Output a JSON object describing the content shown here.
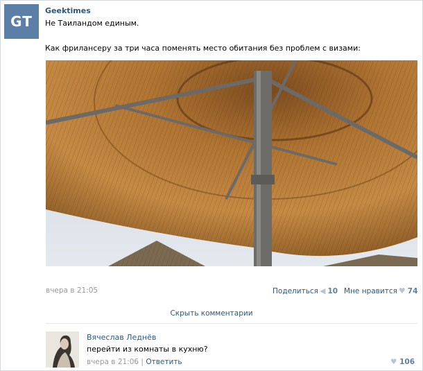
{
  "post": {
    "avatar_text": "GT",
    "author": "Geektimes",
    "line1": "Не Таиландом единым.",
    "line2": "Как фрилансеру за три часа поменять место обитания без проблем с визами:",
    "time": "вчера в 21:05",
    "share_label": "Поделиться",
    "share_count": "10",
    "like_label": "Мне нравится",
    "like_count": "74",
    "hide_comments": "Скрыть комментарии"
  },
  "comment": {
    "author": "Вячеслав Леднёв",
    "text": "перейти из комнаты в кухню?",
    "time": "вчера в 21:06",
    "separator": "|",
    "reply": "Ответить",
    "like_count": "106"
  },
  "icons": {
    "share": "megaphone-icon",
    "like": "heart-icon"
  },
  "colors": {
    "link": "#2b587a",
    "muted": "#999999",
    "avatar_bg": "#5b7fa6"
  }
}
